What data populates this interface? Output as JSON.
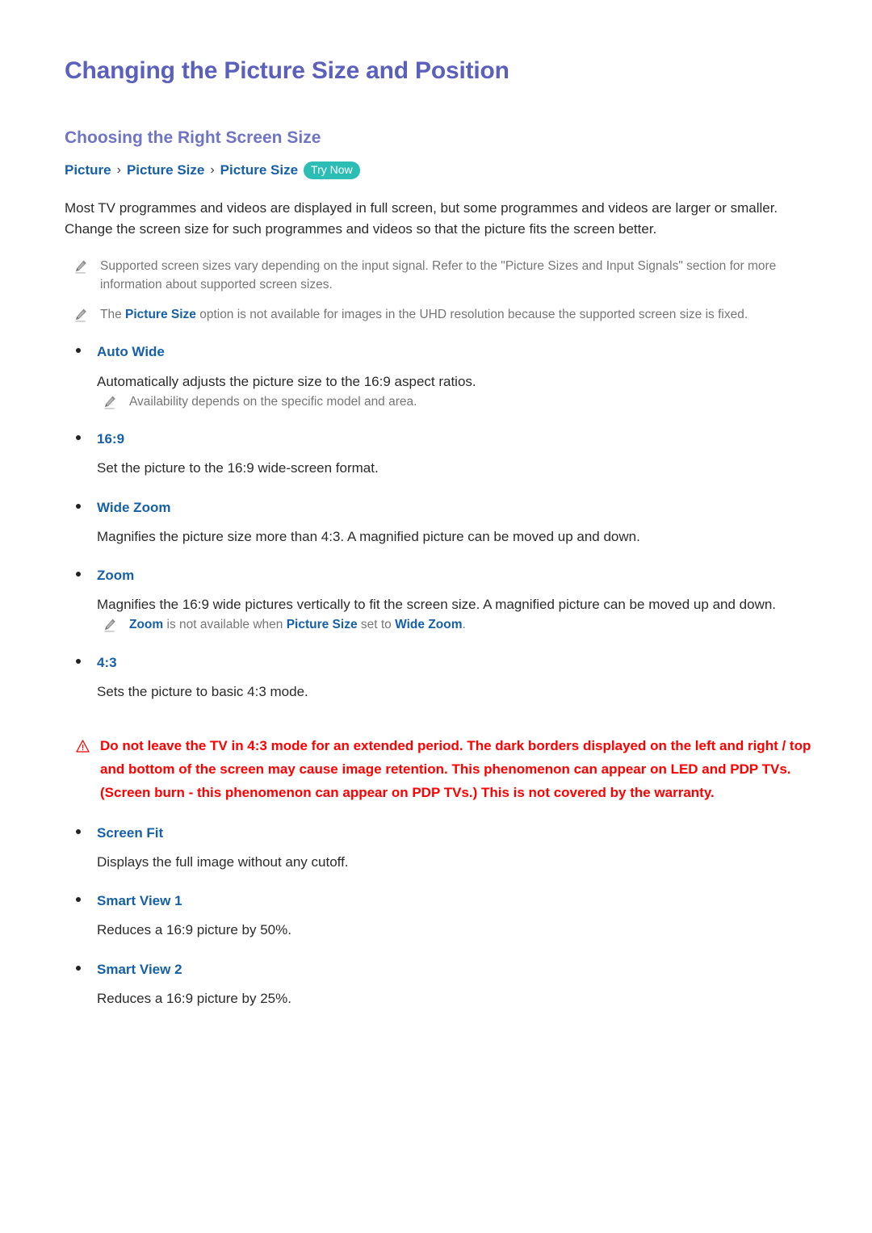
{
  "page_title": "Changing the Picture Size and Position",
  "section": {
    "title": "Choosing the Right Screen Size",
    "breadcrumb": {
      "items": [
        "Picture",
        "Picture Size",
        "Picture Size"
      ],
      "separator": "›",
      "try_now_label": "Try Now"
    },
    "intro_paragraph": "Most TV programmes and videos are displayed in full screen, but some programmes and videos are larger or smaller. Change the screen size for such programmes and videos so that the picture fits the screen better."
  },
  "notes": {
    "note1": "Supported screen sizes vary depending on the input signal. Refer to the \"Picture Sizes and Input Signals\" section for more information about supported screen sizes.",
    "note2_pre": "The ",
    "note2_hl": "Picture Size",
    "note2_post": " option is not available for images in the UHD resolution because the supported screen size is fixed.",
    "note_auto_wide": "Availability depends on the specific model and area.",
    "note_zoom_hl1": "Zoom",
    "note_zoom_mid1": " is not available when ",
    "note_zoom_hl2": "Picture Size",
    "note_zoom_mid2": " set to ",
    "note_zoom_hl3": "Wide Zoom",
    "note_zoom_end": "."
  },
  "options": [
    {
      "label": "Auto Wide",
      "desc": "Automatically adjusts the picture size to the 16:9 aspect ratios."
    },
    {
      "label": "16:9",
      "desc": "Set the picture to the 16:9 wide-screen format."
    },
    {
      "label": "Wide Zoom",
      "desc": "Magnifies the picture size more than 4:3. A magnified picture can be moved up and down."
    },
    {
      "label": "Zoom",
      "desc": "Magnifies the 16:9 wide pictures vertically to fit the screen size. A magnified picture can be moved up and down."
    },
    {
      "label": "4:3",
      "desc": "Sets the picture to basic 4:3 mode."
    },
    {
      "label": "Screen Fit",
      "desc": "Displays the full image without any cutoff."
    },
    {
      "label": "Smart View 1",
      "desc": "Reduces a 16:9 picture by 50%."
    },
    {
      "label": "Smart View 2",
      "desc": "Reduces a 16:9 picture by 25%."
    }
  ],
  "warning": {
    "text": "Do not leave the TV in 4:3 mode for an extended period. The dark borders displayed on the left and right / top and bottom of the screen may cause image retention. This phenomenon can appear on LED and PDP TVs. (Screen burn - this phenomenon can appear on PDP TVs.) This is not covered by the warranty."
  },
  "colors": {
    "page_title": "#5b60bd",
    "section_title": "#6f74c4",
    "link_blue": "#1560a8",
    "try_now_bg": "#2cbdb4",
    "body_text": "#2b2b2b",
    "note_text": "#767676",
    "warning_red": "#ff0000"
  }
}
